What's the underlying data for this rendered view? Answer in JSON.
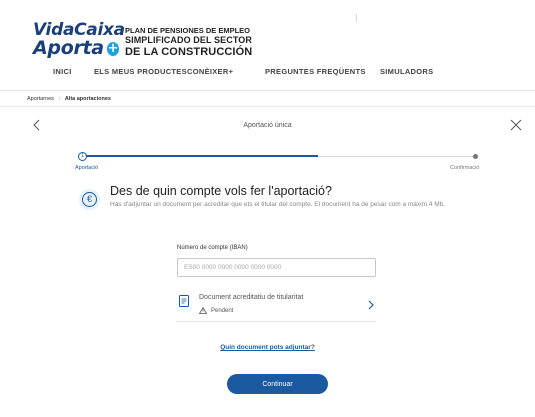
{
  "brand": {
    "logo_line1": "VidaCaixa",
    "logo_line2": "Aporta",
    "logo_plus": "+",
    "plan_small_1": "PLAN DE PENSIONES DE EMPLEO",
    "plan_small_2": "SIMPLIFICADO DEL SECTOR",
    "plan_big": "DE LA CONSTRUCCIÓN"
  },
  "nav": {
    "items": [
      {
        "label": "INICI"
      },
      {
        "label": "ELS MEUS PRODUCTES"
      },
      {
        "label": "CONÈIXER+"
      },
      {
        "label": "PREGUNTES FREQÜENTS"
      },
      {
        "label": "SIMULADORS"
      }
    ]
  },
  "breadcrumb": {
    "items": [
      "Aportarnes",
      "Alta aportaciones"
    ]
  },
  "page": {
    "title": "Aportació única"
  },
  "stepper": {
    "step1_number": "1",
    "step1_label": "Aportació",
    "step2_label": "Confirmació",
    "progress_fraction": 0.6
  },
  "question": {
    "icon": "euro-icon",
    "icon_glyph": "€",
    "title": "Des de quin compte vols fer l'aportació?",
    "description": "Has d'adjuntar un document per acreditar que ets el titular del compte. El document ha de pesar com a màxim 4 Mb."
  },
  "iban": {
    "label": "Número de compte (IBAN)",
    "placeholder": "ES00 0000 0000 0000 0000 0000",
    "value": ""
  },
  "document": {
    "title": "Document acreditatiu de titularitat",
    "status": "Pendent"
  },
  "help_link": "Quin document pots adjuntar?",
  "continue_label": "Continuar",
  "colors": {
    "primary": "#1b5aa0",
    "brand": "#1b3f7a",
    "accent": "#1aa3dc"
  }
}
